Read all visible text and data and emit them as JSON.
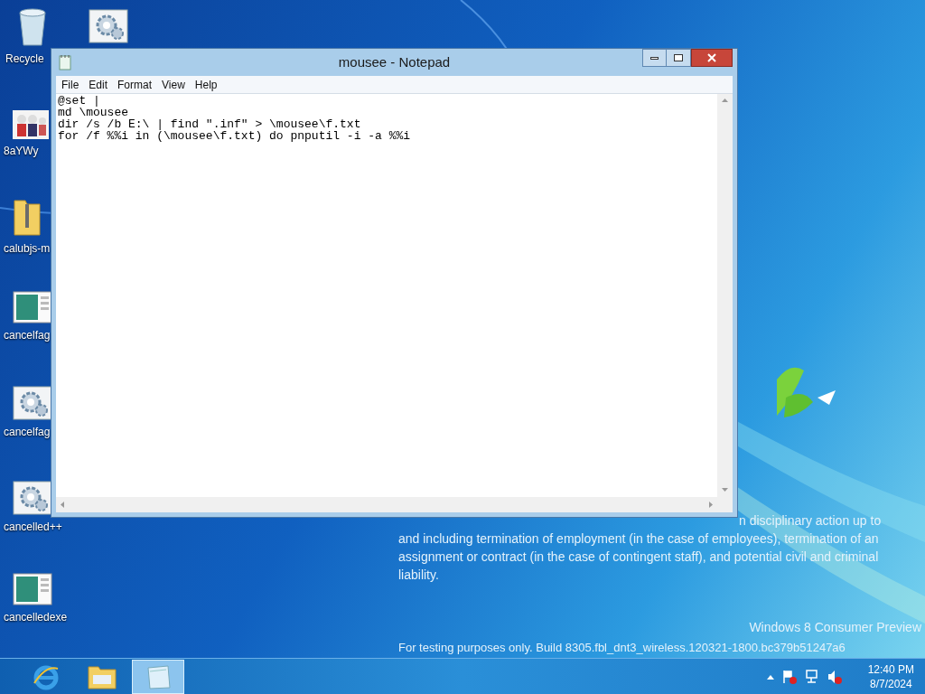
{
  "desktop_icons": [
    {
      "kind": "recycle",
      "label": "Recycle"
    },
    {
      "kind": "gear"
    },
    {
      "kind": "people",
      "label": "8aYWy"
    },
    {
      "kind": "zip",
      "label": "calubjs-m"
    },
    {
      "kind": "window",
      "label": "cancelfag"
    },
    {
      "kind": "gear",
      "label": "cancelfag"
    },
    {
      "kind": "gear",
      "label": "cancelled++"
    },
    {
      "kind": "window",
      "label": "cancelledexe"
    }
  ],
  "notice": {
    "lines": [
      "n disciplinary action up to",
      "and including termination of employment (in the case of employees), termination of an",
      "assignment or contract (in the case of contingent staff), and potential civil and criminal",
      "liability."
    ],
    "edition": "Windows 8 Consumer Preview",
    "build": "For testing purposes only. Build 8305.fbl_dnt3_wireless.120321-1800.bc379b51247a6"
  },
  "window": {
    "title": "mousee - Notepad",
    "menu": [
      "File",
      "Edit",
      "Format",
      "View",
      "Help"
    ],
    "lines": [
      "@set |",
      "md \\mousee",
      "dir /s /b E:\\ | find \".inf\" > \\mousee\\f.txt",
      "for /f %%i in (\\mousee\\f.txt) do pnputil -i -a %%i"
    ]
  },
  "taskbar": {
    "apps": [
      {
        "kind": "browser",
        "selected": false
      },
      {
        "kind": "folder",
        "selected": false
      },
      {
        "kind": "notepad",
        "selected": true
      }
    ],
    "tray": [
      {
        "kind": "arrow"
      },
      {
        "kind": "flag"
      },
      {
        "kind": "network"
      },
      {
        "kind": "volume"
      }
    ],
    "time": "12:40 PM",
    "date": "8/7/2024"
  }
}
